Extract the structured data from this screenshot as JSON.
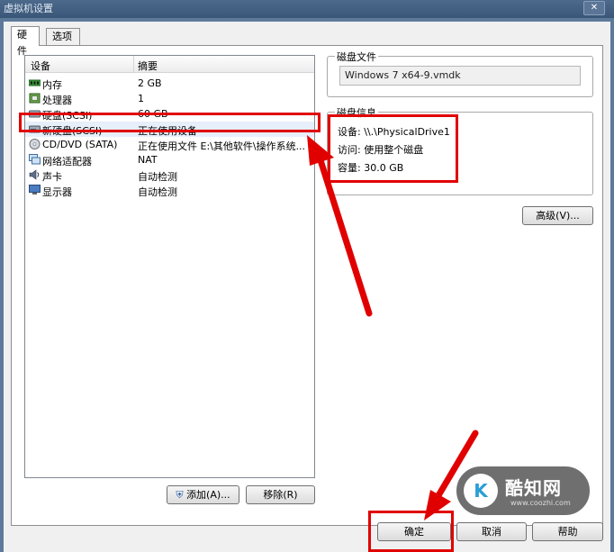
{
  "window": {
    "title": "虚拟机设置",
    "close_label": "✕"
  },
  "tabs": [
    {
      "label": "硬件",
      "active": true
    },
    {
      "label": "选项",
      "active": false
    }
  ],
  "device_list": {
    "columns": [
      "设备",
      "摘要"
    ],
    "rows": [
      {
        "name": "内存",
        "summary": "2 GB",
        "icon": "memory-icon"
      },
      {
        "name": "处理器",
        "summary": "1",
        "icon": "processor-icon"
      },
      {
        "name": "硬盘(SCSI)",
        "summary": "60 GB",
        "icon": "harddisk-icon"
      },
      {
        "name": "新硬盘(SCSI)",
        "summary": "正在使用设备",
        "icon": "harddisk-icon",
        "selected": true
      },
      {
        "name": "CD/DVD (SATA)",
        "summary": "正在使用文件 E:\\其他软件\\操作系统...",
        "icon": "cd-dvd-icon"
      },
      {
        "name": "网络适配器",
        "summary": "NAT",
        "icon": "network-adapter-icon"
      },
      {
        "name": "声卡",
        "summary": "自动检测",
        "icon": "sound-card-icon"
      },
      {
        "name": "显示器",
        "summary": "自动检测",
        "icon": "display-icon"
      }
    ]
  },
  "disk_file": {
    "title": "磁盘文件",
    "value": "Windows 7 x64-9.vmdk"
  },
  "disk_info": {
    "title": "磁盘信息",
    "device": "设备:  \\\\.\\PhysicalDrive1",
    "access": "访问:  使用整个磁盘",
    "capacity": "容量:  30.0 GB"
  },
  "buttons": {
    "advanced": "高级(V)...",
    "add": "添加(A)...",
    "remove": "移除(R)",
    "ok": "确定",
    "cancel": "取消",
    "help": "帮助"
  },
  "watermark": {
    "logo": "K",
    "name": "酷知网",
    "url": "www.coozhi.com"
  },
  "colors": {
    "highlight": "#e10000",
    "frame": "#5d7a9b"
  }
}
